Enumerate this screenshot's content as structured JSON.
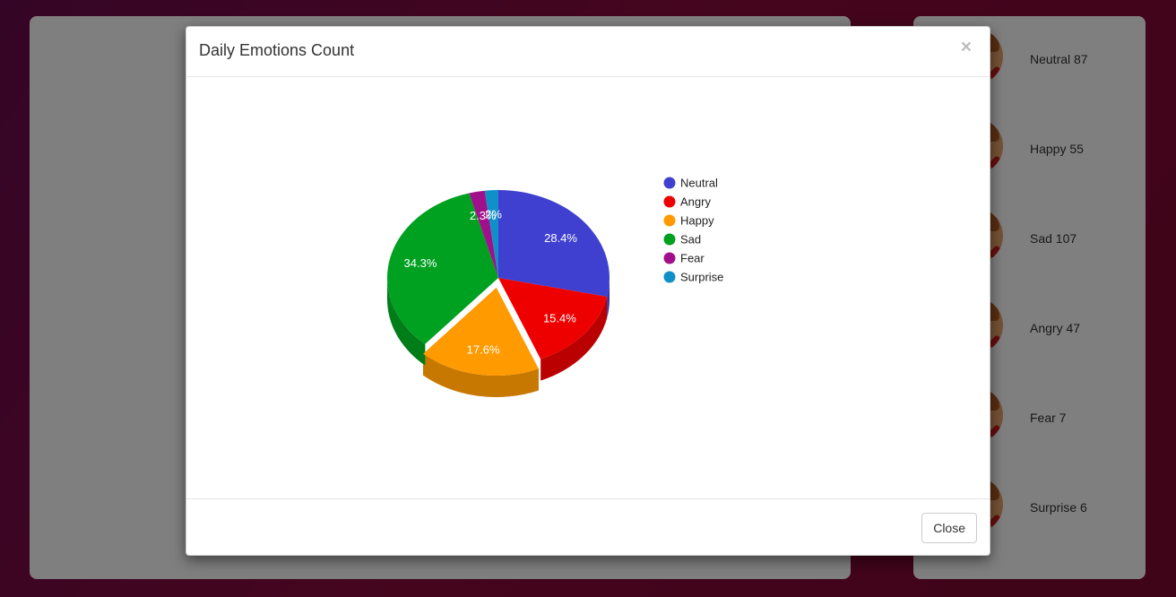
{
  "emotion_list": [
    {
      "name": "Neutral",
      "count": "87",
      "label": "Neutral 87"
    },
    {
      "name": "Happy",
      "count": "55",
      "label": "Happy 55"
    },
    {
      "name": "Sad",
      "count": "107",
      "label": "Sad 107"
    },
    {
      "name": "Angry",
      "count": "47",
      "label": "Angry 47"
    },
    {
      "name": "Fear",
      "count": "7",
      "label": "Fear 7"
    },
    {
      "name": "Surprise",
      "count": "6",
      "label": "Surprise 6"
    }
  ],
  "modal": {
    "title": "Daily Emotions Count",
    "close_icon": "×",
    "close_label": "Close"
  },
  "colors": {
    "Neutral": "#4040d0",
    "Angry": "#ee0000",
    "Happy": "#ff9a00",
    "Sad": "#00a020",
    "Fear": "#a0108a",
    "Surprise": "#1090c8"
  },
  "chart_data": {
    "type": "pie",
    "style": "3d",
    "legend_position": "right",
    "categories": [
      "Neutral",
      "Angry",
      "Happy",
      "Sad",
      "Fear",
      "Surprise"
    ],
    "values": [
      87,
      47,
      54,
      105,
      7,
      6
    ],
    "labels": [
      "28.4%",
      "15.4%",
      "17.6%",
      "34.3%",
      "2.3%",
      "2%"
    ],
    "exploded": "Happy"
  }
}
